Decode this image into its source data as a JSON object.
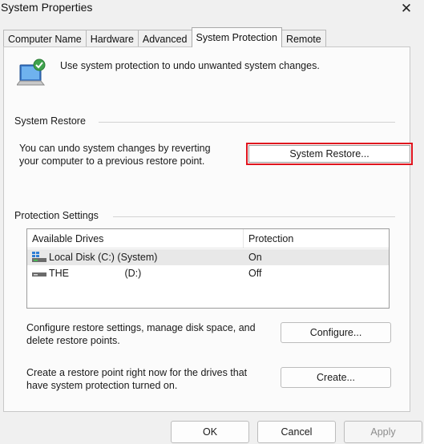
{
  "window": {
    "title": "System Properties",
    "close_glyph": "✕"
  },
  "tabs": [
    {
      "label": "Computer Name",
      "active": false
    },
    {
      "label": "Hardware",
      "active": false
    },
    {
      "label": "Advanced",
      "active": false
    },
    {
      "label": "System Protection",
      "active": true
    },
    {
      "label": "Remote",
      "active": false
    }
  ],
  "intro": {
    "text": "Use system protection to undo unwanted system changes."
  },
  "system_restore": {
    "group_label": "System Restore",
    "description_line1": "You can undo system changes by reverting",
    "description_line2": "your computer to a previous restore point.",
    "button_label": "System Restore...",
    "highlight_color": "#e0141e"
  },
  "protection": {
    "group_label": "Protection Settings",
    "columns": [
      "Available Drives",
      "Protection"
    ],
    "drives": [
      {
        "name": "Local Disk (C:) (System)",
        "protection": "On",
        "icon": "system-drive-icon",
        "selected": true
      },
      {
        "name": "THE                    (D:)",
        "protection": "Off",
        "icon": "drive-icon",
        "selected": false
      }
    ],
    "configure_text_line1": "Configure restore settings, manage disk space, and",
    "configure_text_line2": "delete restore points.",
    "configure_label": "Configure...",
    "create_text_line1": "Create a restore point right now for the drives that",
    "create_text_line2": "have system protection turned on.",
    "create_label": "Create..."
  },
  "footer": {
    "ok": "OK",
    "cancel": "Cancel",
    "apply": "Apply"
  }
}
